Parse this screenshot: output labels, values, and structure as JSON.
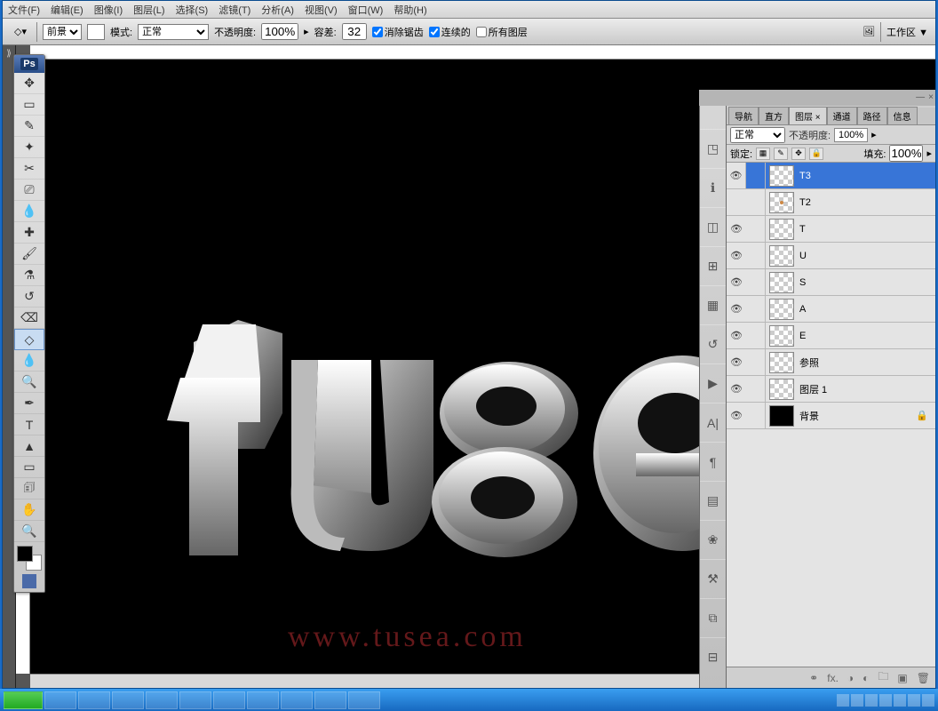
{
  "menu": {
    "items": [
      "文件(F)",
      "编辑(E)",
      "图像(I)",
      "图层(L)",
      "选择(S)",
      "滤镜(T)",
      "分析(A)",
      "视图(V)",
      "窗口(W)",
      "帮助(H)"
    ]
  },
  "options": {
    "fillTarget": "前景",
    "modeLabel": "模式:",
    "mode": "正常",
    "opacityLabel": "不透明度:",
    "opacity": "100%",
    "toleranceLabel": "容差:",
    "tolerance": "32",
    "antialias": "消除锯齿",
    "contiguous": "连续的",
    "allLayers": "所有图层",
    "workspaceLabel": "工作区 ▼"
  },
  "tools": [
    {
      "name": "move",
      "glyph": "✥"
    },
    {
      "name": "marquee",
      "glyph": "▭"
    },
    {
      "name": "lasso",
      "glyph": "✎"
    },
    {
      "name": "magic-wand",
      "glyph": "✦"
    },
    {
      "name": "crop",
      "glyph": "✂"
    },
    {
      "name": "slice",
      "glyph": "⎚"
    },
    {
      "name": "eyedropper",
      "glyph": "💧"
    },
    {
      "name": "healing",
      "glyph": "✚"
    },
    {
      "name": "brush",
      "glyph": "🖌"
    },
    {
      "name": "stamp",
      "glyph": "⚗"
    },
    {
      "name": "history-brush",
      "glyph": "↺"
    },
    {
      "name": "eraser",
      "glyph": "⌫"
    },
    {
      "name": "paint-bucket",
      "glyph": "◇",
      "selected": true
    },
    {
      "name": "blur",
      "glyph": "💧"
    },
    {
      "name": "dodge",
      "glyph": "🔍"
    },
    {
      "name": "pen",
      "glyph": "✒"
    },
    {
      "name": "type",
      "glyph": "T"
    },
    {
      "name": "path-select",
      "glyph": "▲"
    },
    {
      "name": "shape",
      "glyph": "▭"
    },
    {
      "name": "notes",
      "glyph": "🗊"
    },
    {
      "name": "hand",
      "glyph": "✋"
    },
    {
      "name": "zoom",
      "glyph": "🔍"
    }
  ],
  "panels": {
    "tabs": [
      "导航",
      "直方",
      "图层 ×",
      "通道",
      "路径",
      "信息"
    ],
    "activeTab": 2,
    "blendMode": "正常",
    "opacityLabel": "不透明度:",
    "opacity": "100%",
    "lockLabel": "锁定:",
    "fillLabel": "填充:",
    "fill": "100%",
    "layers": [
      {
        "name": "T3",
        "visible": true,
        "selected": true
      },
      {
        "name": "T2",
        "visible": false
      },
      {
        "name": "T",
        "visible": true
      },
      {
        "name": "U",
        "visible": true
      },
      {
        "name": "S",
        "visible": true
      },
      {
        "name": "A",
        "visible": true
      },
      {
        "name": "E",
        "visible": true
      },
      {
        "name": "参照",
        "visible": true
      },
      {
        "name": "图层 1",
        "visible": true
      },
      {
        "name": "背景",
        "visible": true,
        "locked": true,
        "dark": true
      }
    ]
  },
  "iconstrip": [
    {
      "name": "navigator",
      "glyph": "◳"
    },
    {
      "name": "info",
      "glyph": "ℹ"
    },
    {
      "name": "color",
      "glyph": "◫"
    },
    {
      "name": "swatches",
      "glyph": "⊞"
    },
    {
      "name": "styles",
      "glyph": "▦"
    },
    {
      "name": "history",
      "glyph": "↺"
    },
    {
      "name": "actions",
      "glyph": "▶"
    },
    {
      "name": "character",
      "glyph": "A|"
    },
    {
      "name": "paragraph",
      "glyph": "¶"
    },
    {
      "name": "layers-comp",
      "glyph": "▤"
    },
    {
      "name": "brushes",
      "glyph": "❀"
    },
    {
      "name": "tool-presets",
      "glyph": "⚒"
    },
    {
      "name": "clone",
      "glyph": "⧉"
    },
    {
      "name": "channels",
      "glyph": "⊟"
    }
  ],
  "watermark": "www.tusea.com",
  "psLabel": "Ps"
}
